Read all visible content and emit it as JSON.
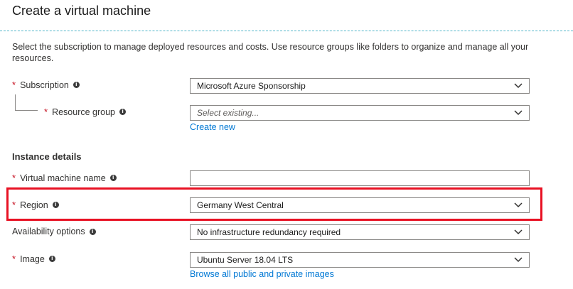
{
  "page": {
    "title": "Create a virtual machine",
    "description": "Select the subscription to manage deployed resources and costs. Use resource groups like folders to organize and manage all your resources."
  },
  "project": {
    "subscription": {
      "required": "*",
      "label": "Subscription",
      "value": "Microsoft Azure Sponsorship"
    },
    "resource_group": {
      "required": "*",
      "label": "Resource group",
      "placeholder": "Select existing...",
      "create_link": "Create new"
    }
  },
  "instance": {
    "heading": "Instance details",
    "vm_name": {
      "required": "*",
      "label": "Virtual machine name",
      "value": ""
    },
    "region": {
      "required": "*",
      "label": "Region",
      "value": "Germany West Central"
    },
    "availability": {
      "label": "Availability options",
      "value": "No infrastructure redundancy required"
    },
    "image": {
      "required": "*",
      "label": "Image",
      "value": "Ubuntu Server 18.04 LTS",
      "browse_link": "Browse all public and private images"
    }
  },
  "icons": {
    "info": "info-icon",
    "dropdown": "chevron-down-icon"
  },
  "colors": {
    "required": "#c50f1f",
    "link": "#0078d4",
    "highlight": "#e81123",
    "divider": "#4fb4c9"
  }
}
